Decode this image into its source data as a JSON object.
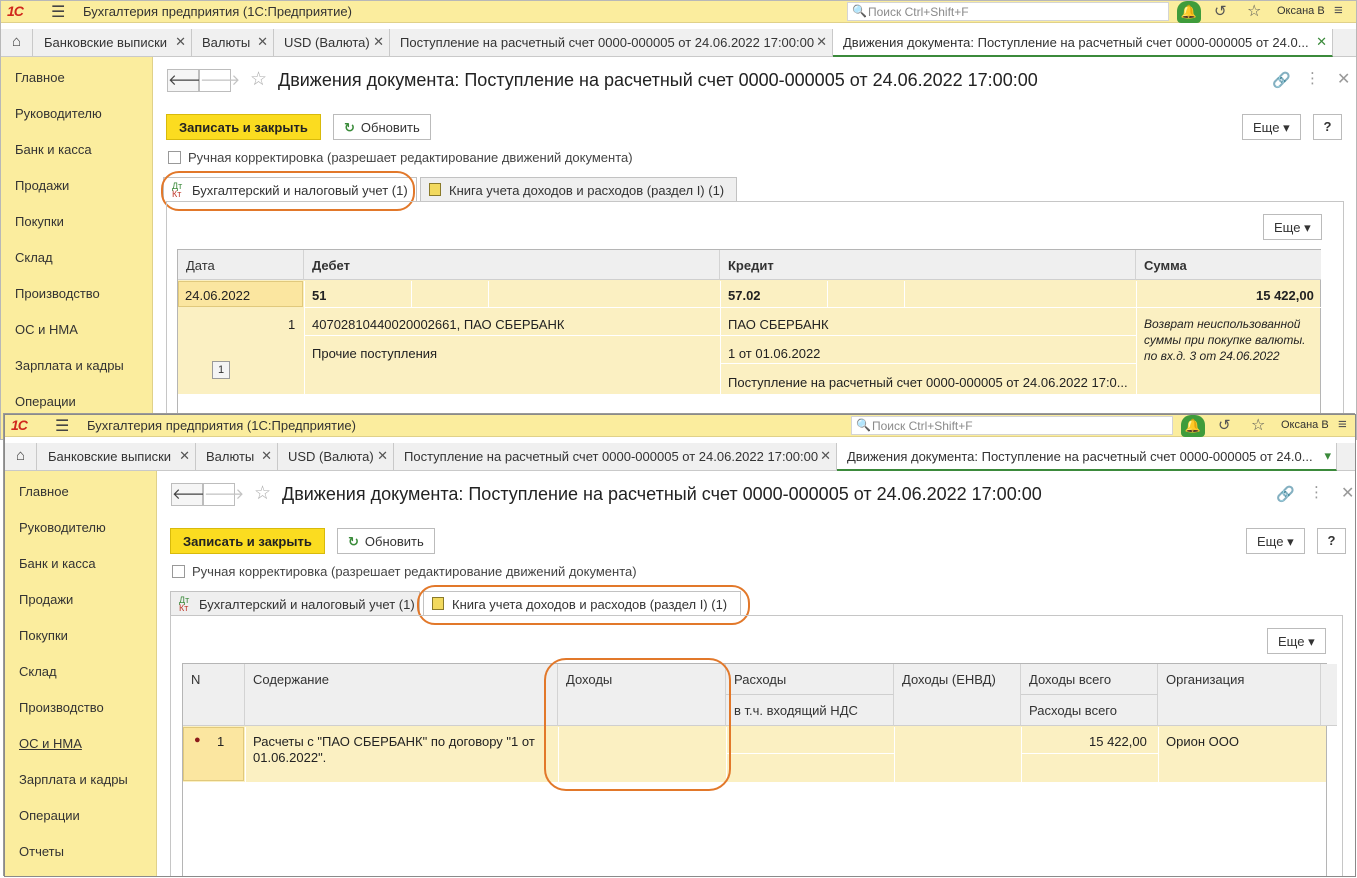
{
  "colors": {
    "titlebar": "#fbed9e",
    "accent_green": "#3b8a3b",
    "save_button": "#fbdc20",
    "highlight_oval": "#e2782a",
    "row_bg": "#fbf0c2"
  },
  "app": {
    "logo": "1С",
    "title": "Бухгалтерия предприятия  (1С:Предприятие)",
    "search_placeholder": "Поиск Ctrl+Shift+F",
    "user": "Оксана В"
  },
  "tabs": [
    "Банковские выписки",
    "Валюты",
    "USD (Валюта)",
    "Поступление на расчетный счет 0000-000005 от 24.06.2022 17:00:00",
    "Движения документа: Поступление на расчетный счет 0000-000005 от 24.0..."
  ],
  "sidebar": [
    "Главное",
    "Руководителю",
    "Банк и касса",
    "Продажи",
    "Покупки",
    "Склад",
    "Производство",
    "ОС и НМА",
    "Зарплата и кадры",
    "Операции",
    "Отчеты"
  ],
  "doc": {
    "title": "Движения документа: Поступление на расчетный счет 0000-000005 от 24.06.2022 17:00:00",
    "save_close": "Записать и закрыть",
    "refresh": "Обновить",
    "more": "Еще",
    "help": "?",
    "manual_correction": "Ручная корректировка (разрешает редактирование движений документа)",
    "subtab_accounting": "Бухгалтерский и налоговый учет (1)",
    "subtab_book": "Книга учета доходов и расходов (раздел I) (1)"
  },
  "accounting_grid": {
    "headers": {
      "date": "Дата",
      "debit": "Дебет",
      "credit": "Кредит",
      "sum": "Сумма"
    },
    "row": {
      "date": "24.06.2022",
      "num": "1",
      "debit_account": "51",
      "debit_sub1": "40702810440020002661, ПАО СБЕРБАНК",
      "debit_sub2": "Прочие поступления",
      "credit_account": "57.02",
      "credit_sub1": "ПАО СБЕРБАНК",
      "credit_sub2": "1 от 01.06.2022",
      "credit_sub3": "Поступление на расчетный счет 0000-000005 от 24.06.2022 17:0...",
      "sum": "15 422,00",
      "comment": "Возврат неиспользованной суммы при покупке валюты. по вх.д. 3 от 24.06.2022",
      "page": "1"
    }
  },
  "book_grid": {
    "headers": {
      "n": "N",
      "content": "Содержание",
      "income": "Доходы",
      "expenses": "Расходы",
      "incl_vat": "в т.ч. входящий НДС",
      "income_envd": "Доходы (ЕНВД)",
      "income_total": "Доходы всего",
      "expenses_total": "Расходы всего",
      "org": "Организация"
    },
    "row": {
      "n": "1",
      "content": "Расчеты с \"ПАО СБЕРБАНК\" по договору \"1 от 01.06.2022\".",
      "income_total": "15 422,00",
      "org": "Орион ООО"
    }
  }
}
